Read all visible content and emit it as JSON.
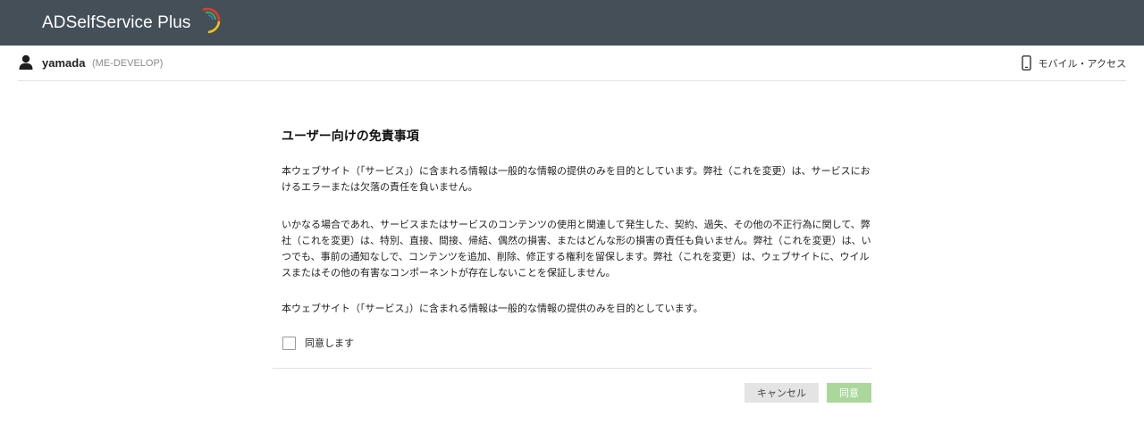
{
  "header": {
    "logo_text": "ADSelfService Plus",
    "bg_color": "#444f58"
  },
  "userbar": {
    "username": "yamada",
    "domain": "(ME-DEVELOP)",
    "mobile_access": "モバイル・アクセス"
  },
  "disclaimer": {
    "title": "ユーザー向けの免責事項",
    "paragraph1": "本ウェブサイト（「サービス」）に含まれる情報は一般的な情報の提供のみを目的としています。弊社（これを変更）は、サービスにおけるエラーまたは欠落の責任を負いません。",
    "paragraph2": "いかなる場合であれ、サービスまたはサービスのコンテンツの使用と関連して発生した、契約、過失、その他の不正行為に関して、弊社（これを変更）は、特別、直接、間接、帰結、偶然の損害、またはどんな形の損害の責任も負いません。弊社（これを変更）は、いつでも、事前の通知なしで、コンテンツを追加、削除、修正する権利を留保します。弊社（これを変更）は、ウェブサイトに、ウイルスまたはその他の有害なコンポーネントが存在しないことを保証しません。",
    "paragraph3": "本ウェブサイト（「サービス」）に含まれる情報は一般的な情報の提供のみを目的としています。",
    "agree_checkbox_label": "同意します",
    "agree_checked": false
  },
  "buttons": {
    "cancel": "キャンセル",
    "agree": "同意"
  },
  "colors": {
    "agree_button": "#a9d89a",
    "cancel_button": "#e4e4e4"
  }
}
